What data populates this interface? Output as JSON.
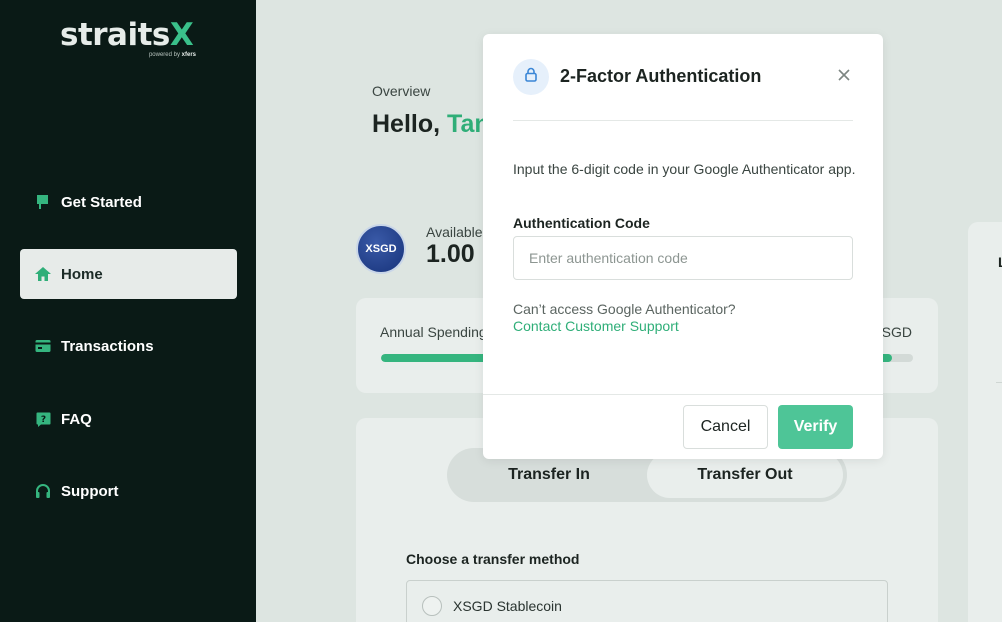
{
  "sidebar": {
    "logo": {
      "word_main": "straits",
      "word_accent": "X",
      "powered_by": "powered by",
      "powered_brand": "xfers"
    },
    "items": [
      {
        "label": "Get Started",
        "icon": "flag-icon",
        "active": false
      },
      {
        "label": "Home",
        "icon": "home-icon",
        "active": true
      },
      {
        "label": "Transactions",
        "icon": "transactions-icon",
        "active": false
      },
      {
        "label": "FAQ",
        "icon": "faq-icon",
        "active": false
      },
      {
        "label": "Support",
        "icon": "headset-icon",
        "active": false
      }
    ]
  },
  "main": {
    "overview_label": "Overview",
    "greeting": "Hello,",
    "greeting_name": "Tan",
    "coin_label": "XSGD",
    "balance_label": "Available",
    "balance_value": "1.00",
    "spending": {
      "label": "Annual Spending",
      "unit": "SGD",
      "progress_percent": 96
    },
    "transfer_tabs": [
      {
        "label": "Transfer In"
      },
      {
        "label": "Transfer Out"
      }
    ],
    "method_title": "Choose a transfer method",
    "methods": [
      {
        "label": "XSGD Stablecoin"
      }
    ],
    "right_card_label": "L"
  },
  "modal": {
    "title": "2-Factor Authentication",
    "instruction": "Input the 6-digit code in your Google Authenticator app.",
    "field_label": "Authentication Code",
    "input_value": "",
    "input_placeholder": "Enter authentication code",
    "cant_access": "Can’t access Google Authenticator?",
    "support_link": "Contact Customer Support",
    "cancel_label": "Cancel",
    "verify_label": "Verify"
  },
  "colors": {
    "sidebar_bg": "#0a1a16",
    "accent_green": "#2fae78",
    "verify_button": "#4ec597",
    "lock_circle_bg": "#e6f0fb",
    "lock_icon": "#3a86d6"
  }
}
